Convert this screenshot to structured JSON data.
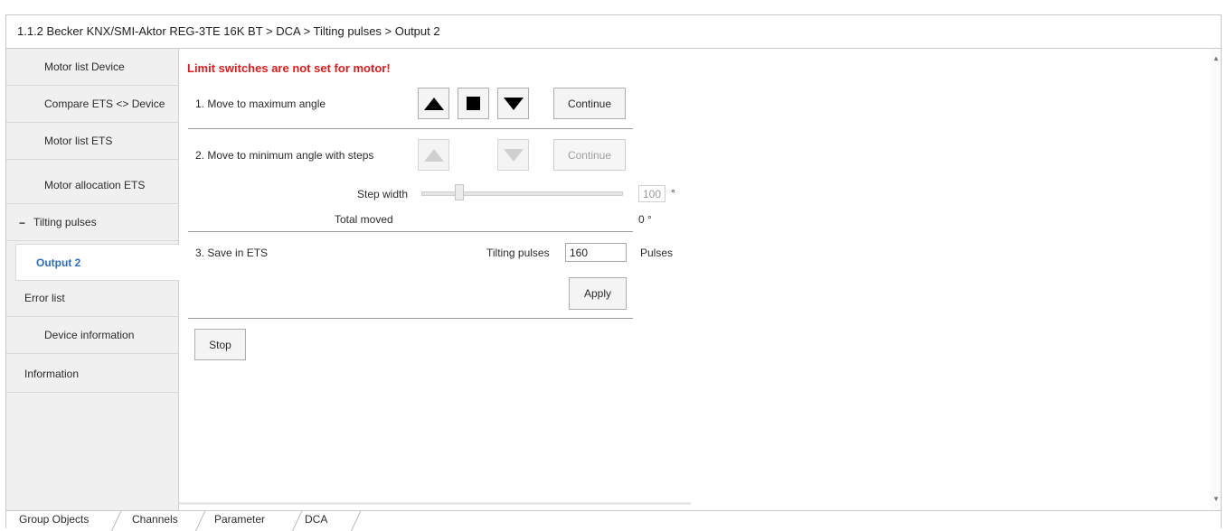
{
  "title": "1.1.2 Becker KNX/SMI-Aktor REG-3TE 16K BT > DCA > Tilting pulses > Output 2",
  "sidebar": {
    "items": [
      {
        "label": "Motor list Device"
      },
      {
        "label": "Compare ETS <> Device"
      },
      {
        "label": "Motor list ETS"
      },
      {
        "label": "Motor allocation ETS"
      },
      {
        "label": "Tilting pulses",
        "expander": "−"
      },
      {
        "label": "Output 2"
      },
      {
        "label": "Error list"
      },
      {
        "label": "Device information"
      },
      {
        "label": "Information"
      }
    ]
  },
  "main": {
    "warning": "Limit switches are not set for motor!",
    "step1": {
      "label": "1.  Move to maximum angle",
      "continue": "Continue"
    },
    "step2": {
      "label": "2.  Move to minimum angle with steps",
      "continue": "Continue"
    },
    "step_width": {
      "label": "Step width",
      "value": "100",
      "unit": "°",
      "slider_fraction": 0.17
    },
    "total_moved": {
      "label": "Total moved",
      "value": "0 °"
    },
    "step3": {
      "label": "3.  Save in ETS",
      "pulses_label": "Tilting pulses",
      "pulses_value": "160",
      "pulses_unit": "Pulses",
      "apply": "Apply"
    },
    "stop": "Stop"
  },
  "tabs": [
    {
      "label": "Group Objects"
    },
    {
      "label": "Channels"
    },
    {
      "label": "Parameter"
    },
    {
      "label": "DCA",
      "active": true
    }
  ],
  "colors": {
    "warning": "#d81e1e",
    "active_item": "#2e6eb5"
  }
}
